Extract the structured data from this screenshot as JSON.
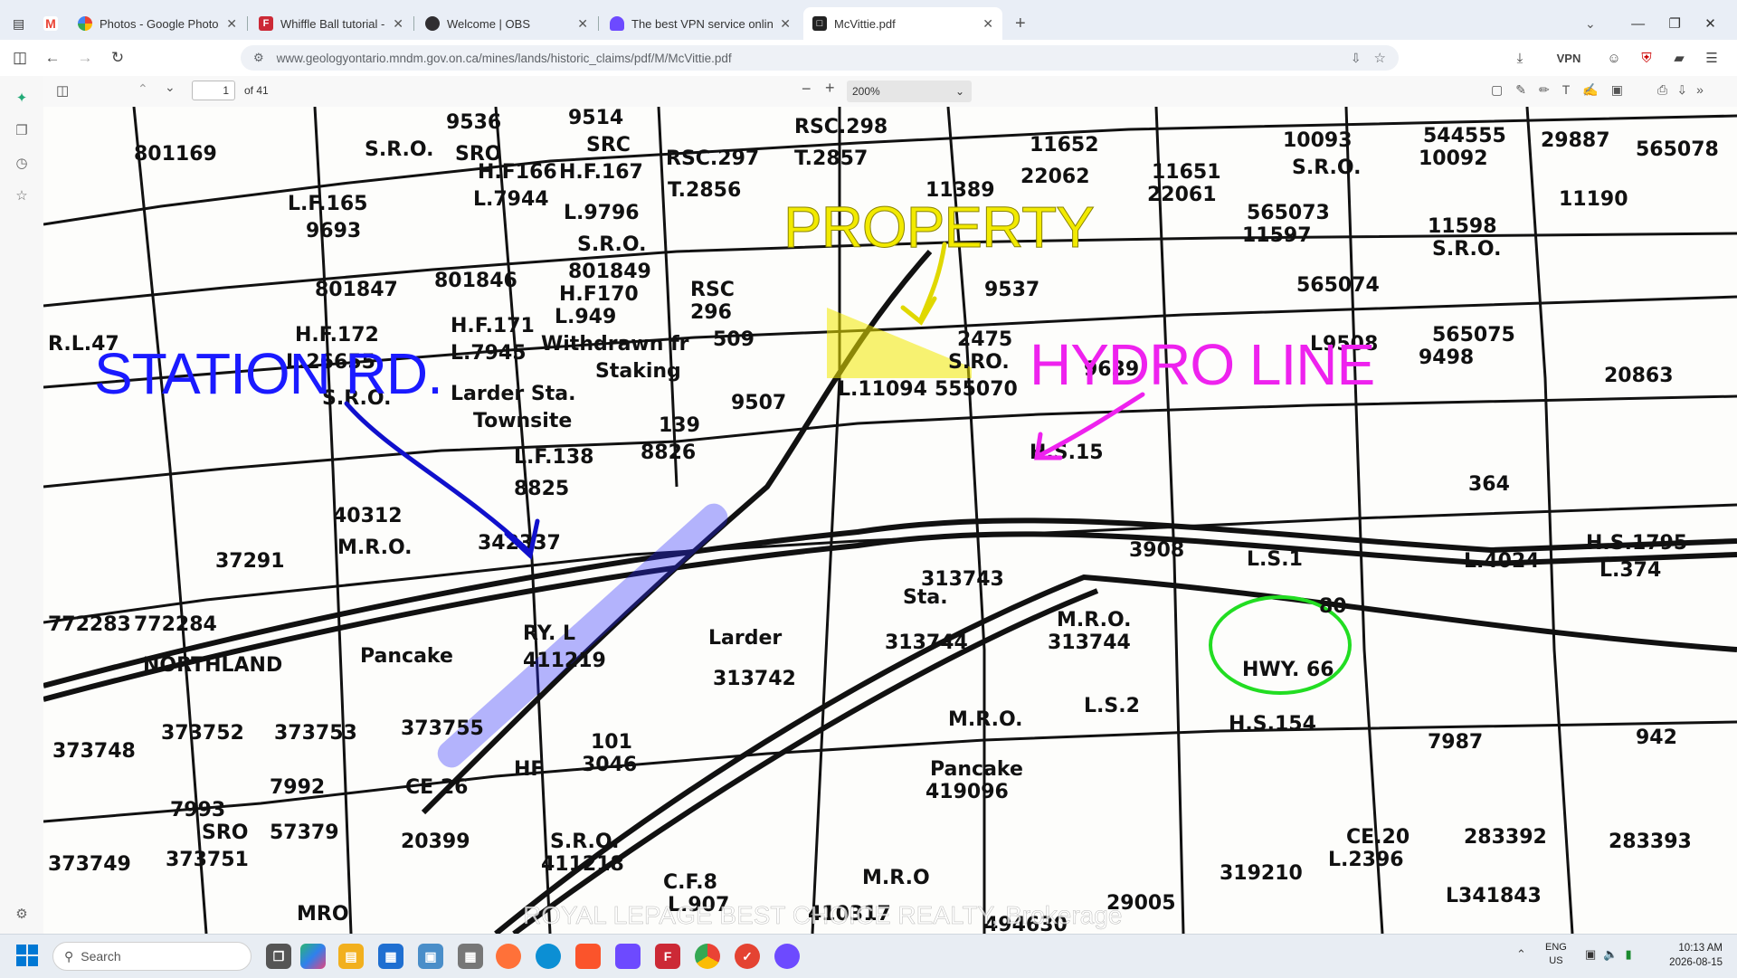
{
  "tabs": [
    {
      "title": "Photos - Google Photos",
      "icon": "google-photos-icon",
      "color": "#ea4335"
    },
    {
      "title": "Whiffle Ball tutorial - FreeCAD D",
      "icon": "freecad-icon",
      "color": "#cc2936"
    },
    {
      "title": "Welcome | OBS",
      "icon": "obs-icon",
      "color": "#302e31"
    },
    {
      "title": "The best VPN service online for",
      "icon": "vpn-icon",
      "color": "#6d4aff"
    },
    {
      "title": "McVittie.pdf",
      "icon": "pdf-icon",
      "color": "#222222"
    }
  ],
  "address_bar": {
    "url": "www.geologyontario.mndm.gov.on.ca/mines/lands/historic_claims/pdf/M/McVittie.pdf",
    "vpn_label": "VPN"
  },
  "pdf_toolbar": {
    "page_current": "1",
    "page_total": "of 41",
    "zoom": "200%"
  },
  "map": {
    "annotations": {
      "station": "STATION RD.",
      "property": "PROPERTY",
      "hydro": "HYDRO LINE"
    },
    "annotation_colors": {
      "station": "#1a1aff",
      "property": "#f2ea00",
      "hydro": "#ee22ee",
      "highway": "#22dd22"
    },
    "labels": [
      {
        "text": "9536"
      },
      {
        "text": "SRO"
      },
      {
        "text": "9514"
      },
      {
        "text": "SRC"
      },
      {
        "text": "RSC.298"
      },
      {
        "text": "T.2857"
      },
      {
        "text": "11652"
      },
      {
        "text": "22062"
      },
      {
        "text": "10093"
      },
      {
        "text": "S.R.O."
      },
      {
        "text": "544555"
      },
      {
        "text": "10092"
      },
      {
        "text": "29887"
      },
      {
        "text": "565078"
      },
      {
        "text": "801169"
      },
      {
        "text": "S.R.O."
      },
      {
        "text": "H.F166"
      },
      {
        "text": "L.7944"
      },
      {
        "text": "H.F.167"
      },
      {
        "text": "RSC.297"
      },
      {
        "text": "T.2856"
      },
      {
        "text": "11389"
      },
      {
        "text": "11651"
      },
      {
        "text": "22061"
      },
      {
        "text": "11190"
      },
      {
        "text": "L.F.165"
      },
      {
        "text": "9693"
      },
      {
        "text": "L.9796"
      },
      {
        "text": "S.R.O."
      },
      {
        "text": "801849"
      },
      {
        "text": "565073"
      },
      {
        "text": "11597"
      },
      {
        "text": "11598"
      },
      {
        "text": "S.R.O."
      },
      {
        "text": "801847"
      },
      {
        "text": "801846"
      },
      {
        "text": "H.F170"
      },
      {
        "text": "L.949"
      },
      {
        "text": "RSC"
      },
      {
        "text": "296"
      },
      {
        "text": "9537"
      },
      {
        "text": "565074"
      },
      {
        "text": "H.F.172"
      },
      {
        "text": "L.26655"
      },
      {
        "text": "H.F.171"
      },
      {
        "text": "L.7945"
      },
      {
        "text": "Withdrawn fr"
      },
      {
        "text": "Staking"
      },
      {
        "text": "509"
      },
      {
        "text": "2475"
      },
      {
        "text": "S.RO."
      },
      {
        "text": "L9508"
      },
      {
        "text": "565075"
      },
      {
        "text": "9498"
      },
      {
        "text": "R.L.47"
      },
      {
        "text": "S.R.O."
      },
      {
        "text": "Larder Sta."
      },
      {
        "text": "Townsite"
      },
      {
        "text": "9639"
      },
      {
        "text": "20863"
      },
      {
        "text": "L.11094"
      },
      {
        "text": "555070"
      },
      {
        "text": "139"
      },
      {
        "text": "L.F.138"
      },
      {
        "text": "8825"
      },
      {
        "text": "8826"
      },
      {
        "text": "9507"
      },
      {
        "text": "40312"
      },
      {
        "text": "M.R.O."
      },
      {
        "text": "342337"
      },
      {
        "text": "H.S.15"
      },
      {
        "text": "364"
      },
      {
        "text": "37291"
      },
      {
        "text": "3908"
      },
      {
        "text": "L.S.1"
      },
      {
        "text": "L.4024"
      },
      {
        "text": "H.S.1795"
      },
      {
        "text": "L.374"
      },
      {
        "text": "313743"
      },
      {
        "text": "Sta."
      },
      {
        "text": "80"
      },
      {
        "text": "Larder"
      },
      {
        "text": "772283"
      },
      {
        "text": "772284"
      },
      {
        "text": "RY. L"
      },
      {
        "text": "411219"
      },
      {
        "text": "NORTHLAND"
      },
      {
        "text": "Pancake"
      },
      {
        "text": "313742"
      },
      {
        "text": "M.R.O."
      },
      {
        "text": "313744"
      },
      {
        "text": "313744"
      },
      {
        "text": "HWY. 66"
      },
      {
        "text": "373748"
      },
      {
        "text": "373752"
      },
      {
        "text": "373753"
      },
      {
        "text": "373755"
      },
      {
        "text": "L.S.2"
      },
      {
        "text": "H.S.154"
      },
      {
        "text": "7987"
      },
      {
        "text": "942"
      },
      {
        "text": "HF"
      },
      {
        "text": "101"
      },
      {
        "text": "3046"
      },
      {
        "text": "M.R.O."
      },
      {
        "text": "Pancake"
      },
      {
        "text": "7993"
      },
      {
        "text": "SRO"
      },
      {
        "text": "7992"
      },
      {
        "text": "CE 26"
      },
      {
        "text": "419096"
      },
      {
        "text": "20399"
      },
      {
        "text": "S.R.O."
      },
      {
        "text": "411218"
      },
      {
        "text": "373751"
      },
      {
        "text": "57379"
      },
      {
        "text": "283392"
      },
      {
        "text": "283393"
      },
      {
        "text": "CE.20"
      },
      {
        "text": "L.2396"
      },
      {
        "text": "319210"
      },
      {
        "text": "C.F.8"
      },
      {
        "text": "L.907"
      },
      {
        "text": "M.R.O"
      },
      {
        "text": "410317"
      },
      {
        "text": "L341843"
      },
      {
        "text": "494630"
      },
      {
        "text": "29005"
      },
      {
        "text": "MRO"
      },
      {
        "text": "373749"
      }
    ],
    "watermark": "ROYAL LEPAGE BEST CHOICE REALTY, Brokerage"
  },
  "taskbar": {
    "search_placeholder": "Search",
    "lang_line1": "ENG",
    "lang_line2": "US",
    "time": "10:13 AM",
    "date": "2026-08-15",
    "apps": [
      "file-explorer-icon",
      "store-icon",
      "copilot-icon",
      "firefox-icon",
      "edge-icon",
      "brave-icon",
      "proton-icon",
      "freecad-icon",
      "chrome-icon",
      "todoist-icon",
      "vpn-icon"
    ]
  }
}
